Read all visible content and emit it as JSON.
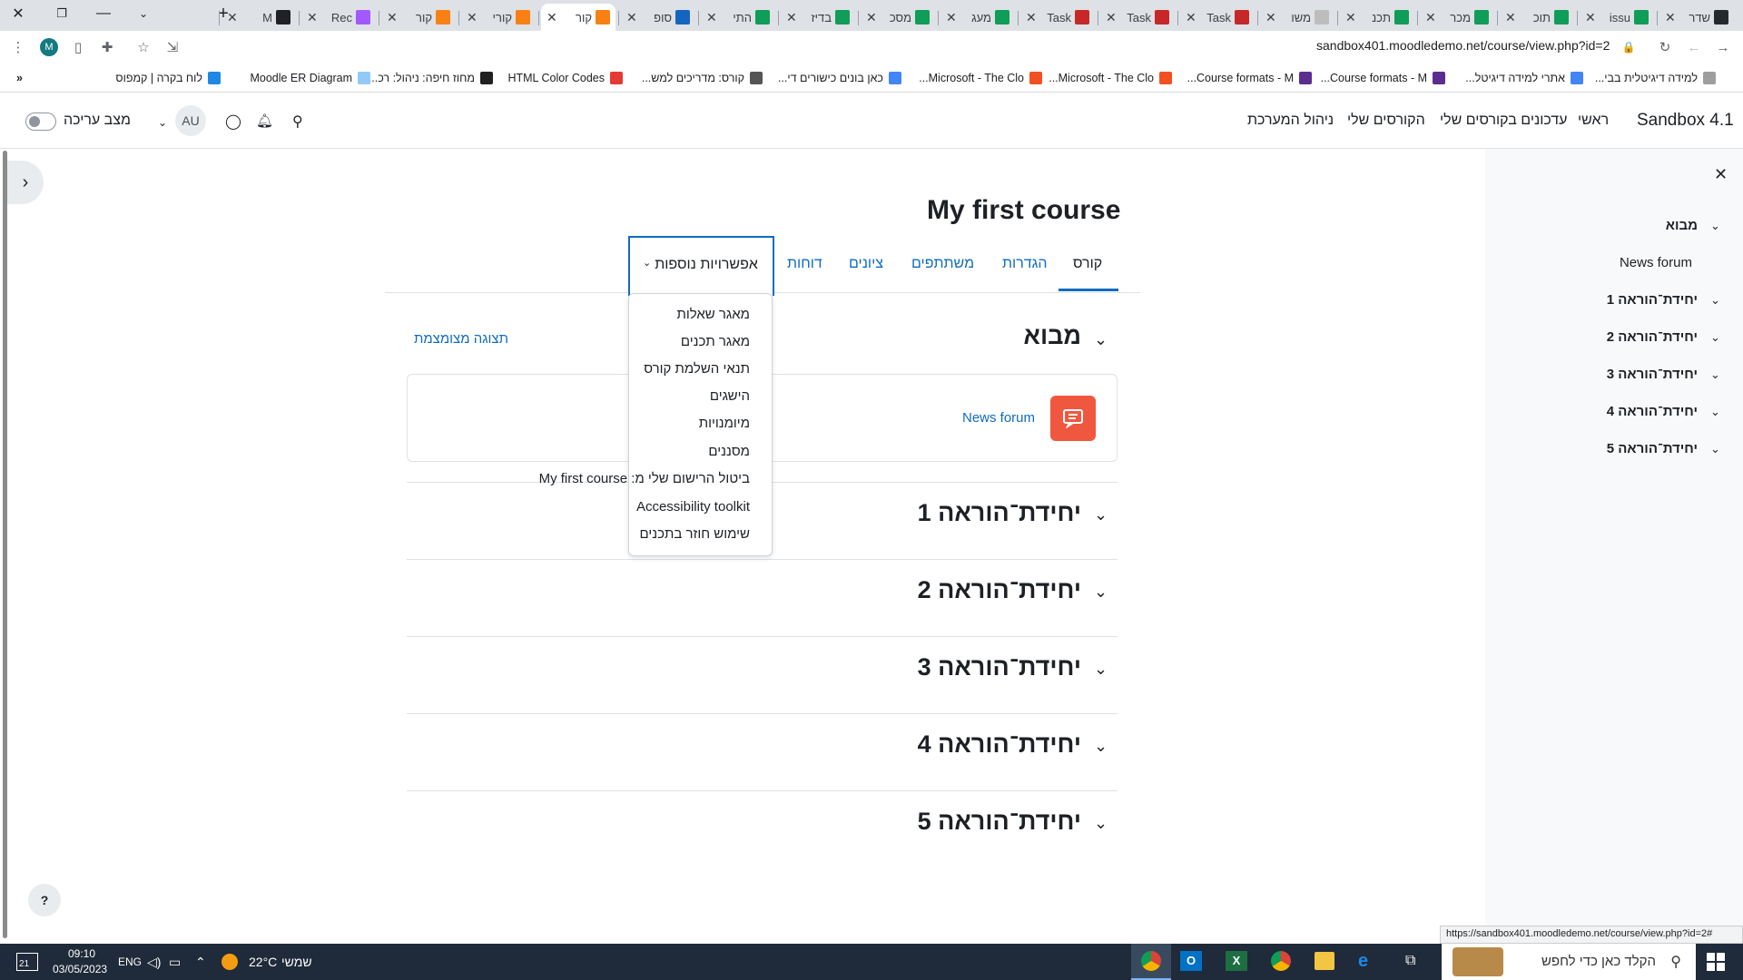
{
  "browser": {
    "tabs": [
      {
        "label": "שדר",
        "favicon": "github-icon",
        "color": "#24292e"
      },
      {
        "label": "issu",
        "favicon": "plus-sheet-icon",
        "color": "#0f9d58"
      },
      {
        "label": "תוכ",
        "favicon": "plus-sheet-icon",
        "color": "#0f9d58"
      },
      {
        "label": "מכר",
        "favicon": "plus-sheet-icon",
        "color": "#0f9d58"
      },
      {
        "label": "תכנ",
        "favicon": "plus-sheet-icon",
        "color": "#0f9d58"
      },
      {
        "label": "משו",
        "favicon": "doc-icon",
        "color": "#bdbdbd"
      },
      {
        "label": "Task",
        "favicon": "r-icon",
        "color": "#c62828"
      },
      {
        "label": "Task",
        "favicon": "r-icon",
        "color": "#c62828"
      },
      {
        "label": "Task",
        "favicon": "r-icon",
        "color": "#c62828"
      },
      {
        "label": "מעג",
        "favicon": "plus-sheet-icon",
        "color": "#0f9d58"
      },
      {
        "label": "מסכ",
        "favicon": "plus-sheet-icon",
        "color": "#0f9d58"
      },
      {
        "label": "בדיז",
        "favicon": "plus-sheet-icon",
        "color": "#0f9d58"
      },
      {
        "label": "התי",
        "favicon": "plus-sheet-icon",
        "color": "#0f9d58"
      },
      {
        "label": "סופ",
        "favicon": "moodle-blue-icon",
        "color": "#1565c0"
      },
      {
        "label": "קור",
        "favicon": "moodle-icon",
        "color": "#f98012"
      },
      {
        "label": "קורי",
        "favicon": "moodle-icon",
        "color": "#f98012"
      },
      {
        "label": "קור",
        "favicon": "moodle-icon",
        "color": "#f98012"
      },
      {
        "label": "Rec",
        "favicon": "figma-icon",
        "color": "#a259ff"
      },
      {
        "label": "M",
        "favicon": "play-icon",
        "color": "#202124"
      }
    ],
    "url": "sandbox401.moodledemo.net/course/view.php?id=2",
    "profile_initial": "M",
    "bookmarks": [
      {
        "label": "למידה דיגיטלית בבי...",
        "color": "#9e9e9e"
      },
      {
        "label": "אתרי למידה דיגיטל...",
        "color": "#4285f4"
      },
      {
        "label": "Course formats - M...",
        "color": "#5c2d91"
      },
      {
        "label": "Course formats - M...",
        "color": "#5c2d91"
      },
      {
        "label": "Microsoft - The Clo...",
        "color": "#f25022"
      },
      {
        "label": "Microsoft - The Clo...",
        "color": "#f25022"
      },
      {
        "label": "כאן בונים כישורים די...",
        "color": "#4285f4"
      },
      {
        "label": "קורס: מדריכים למש...",
        "color": "#555555"
      },
      {
        "label": "HTML Color Codes",
        "color": "#e53935"
      },
      {
        "label": "מחוז חיפה: ניהול: רכ...",
        "color": "#212121"
      },
      {
        "label": "Moodle ER Diagram",
        "color": "#90caf9"
      },
      {
        "label": "לוח בקרה | קמפוס",
        "color": "#1e88e5"
      }
    ]
  },
  "navbar": {
    "brand": "Sandbox 4.1",
    "links": [
      "ראשי",
      "עדכונים בקורסים שלי",
      "הקורסים שלי",
      "ניהול המערכת"
    ],
    "avatar": "AU",
    "edit_mode_label": "מצב עריכה"
  },
  "course": {
    "title": "My first course",
    "tabs": [
      "קורס",
      "הגדרות",
      "משתתפים",
      "ציונים",
      "דוחות",
      "אפשרויות נוספות"
    ],
    "more_menu": [
      "מאגר שאלות",
      "מאגר תכנים",
      "תנאי השלמת קורס",
      "הישגים",
      "מיומנויות",
      "מסננים",
      "ביטול הרישום שלי מ: My first course",
      "Accessibility toolkit",
      "שימוש חוזר בתכנים"
    ],
    "collapse_all": "תצוגה מצומצמת",
    "sections": [
      "מבוא",
      "יחידת־הוראה 1",
      "יחידת־הוראה 2",
      "יחידת־הוראה 3",
      "יחידת־הוראה 4",
      "יחידת־הוראה 5"
    ],
    "news_forum": "News forum"
  },
  "course_index": {
    "items": [
      "מבוא",
      "News forum",
      "יחידת־הוראה 1",
      "יחידת־הוראה 2",
      "יחידת־הוראה 3",
      "יחידת־הוראה 4",
      "יחידת־הוראה 5"
    ]
  },
  "status_url": "https://sandbox401.moodledemo.net/course/view.php?id=2#",
  "taskbar": {
    "search_placeholder": "הקלד כאן כדי לחפש",
    "weather_temp": "22°C",
    "weather_label": "שמשי",
    "lang": "ENG",
    "time": "09:10",
    "date": "03/05/2023",
    "notification_count": "21"
  }
}
